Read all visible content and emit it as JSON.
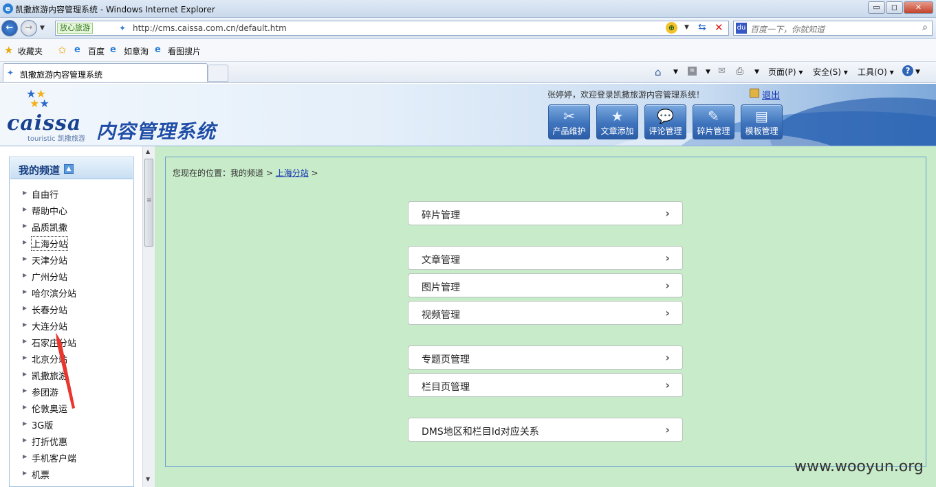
{
  "window": {
    "title": "凯撒旅游内容管理系统 - Windows Internet Explorer",
    "minimize": "▭",
    "maximize": "◻",
    "close": "✕"
  },
  "addressbar": {
    "safe_label": "放心旅游",
    "url": "http://cms.caissa.com.cn/default.htm",
    "search_placeholder": "百度一下，你就知道"
  },
  "favorites": {
    "label": "收藏夹",
    "items": [
      "百度",
      "如意淘",
      "看图搜片"
    ]
  },
  "tab": {
    "label": "凯撒旅游内容管理系统"
  },
  "commandbar": {
    "page": "页面(P)",
    "safety": "安全(S)",
    "tools": "工具(O)",
    "help": "?"
  },
  "header": {
    "logo_text": "caissa",
    "logo_sub": "touristic 凯撒旅游",
    "system_title": "内容管理系统",
    "welcome": "张婷婷，欢迎登录凯撒旅游内容管理系统！",
    "logout": "退出",
    "toolbar": [
      {
        "label": "产品维护",
        "icon": "tools-icon"
      },
      {
        "label": "文章添加",
        "icon": "star-add-icon"
      },
      {
        "label": "评论管理",
        "icon": "chat-bubble-icon"
      },
      {
        "label": "碎片管理",
        "icon": "document-edit-icon"
      },
      {
        "label": "模板管理",
        "icon": "template-icon"
      }
    ]
  },
  "sidebar": {
    "title": "我的频道",
    "items": [
      "自由行",
      "帮助中心",
      "品质凯撒",
      "上海分站",
      "天津分站",
      "广州分站",
      "哈尔滨分站",
      "长春分站",
      "大连分站",
      "石家庄分站",
      "北京分站",
      "凯撒旅游",
      "参团游",
      "伦敦奥运",
      "3G版",
      "打折优惠",
      "手机客户端",
      "机票"
    ],
    "selected_index": 3
  },
  "breadcrumb": {
    "prefix": "您现在的位置：我的频道 >",
    "link": "上海分站",
    "suffix": ">"
  },
  "menu": [
    {
      "label": "碎片管理"
    },
    {
      "label": "文章管理"
    },
    {
      "label": "图片管理"
    },
    {
      "label": "视频管理"
    },
    {
      "label": "专题页管理"
    },
    {
      "label": "栏目页管理"
    },
    {
      "label": "DMS地区和栏目Id对应关系"
    }
  ],
  "watermark": "www.wooyun.org",
  "colors": {
    "content_bg": "#c8ebc9",
    "toolbar_blue": "#3f74bd",
    "annotation_arrow": "#e8372e"
  }
}
